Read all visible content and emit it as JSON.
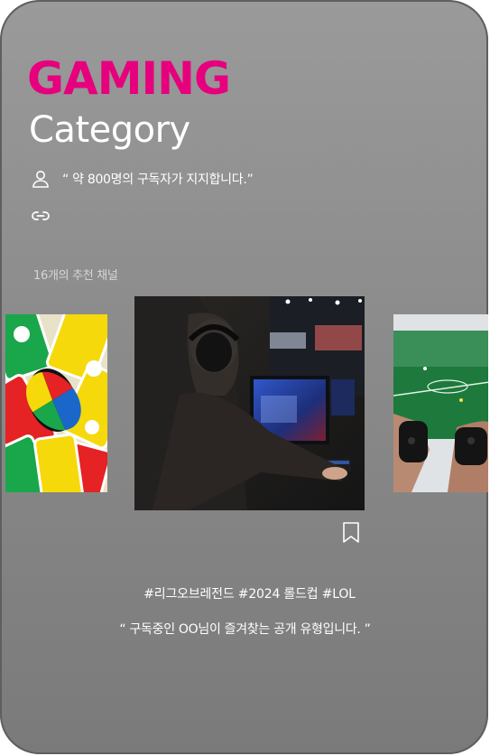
{
  "header": {
    "title": "GAMING",
    "subtitle": "Category"
  },
  "info": {
    "subscribers_text": "“ 약 800명의 구독자가 지지합니다.”",
    "user_icon": "user-icon",
    "link_icon": "link-icon"
  },
  "recommendations": {
    "count_label": "16개의 추천 채널",
    "thumbnails": [
      {
        "name": "uno-cards-thumbnail",
        "subject": "UNO cards"
      },
      {
        "name": "pc-gamer-thumbnail",
        "subject": "gamer at PC"
      },
      {
        "name": "console-controllers-thumbnail",
        "subject": "console controllers"
      }
    ]
  },
  "featured": {
    "bookmark_icon": "bookmark-icon",
    "tags": "#리그오브레전드 #2024 롤드컵 #LOL",
    "description": "“ 구독중인 OO님이 즐겨찾는 공개 유형입니다. ”"
  },
  "colors": {
    "accent": "#e6007e",
    "card_background": "#8e8e8e",
    "text": "#ffffff"
  }
}
